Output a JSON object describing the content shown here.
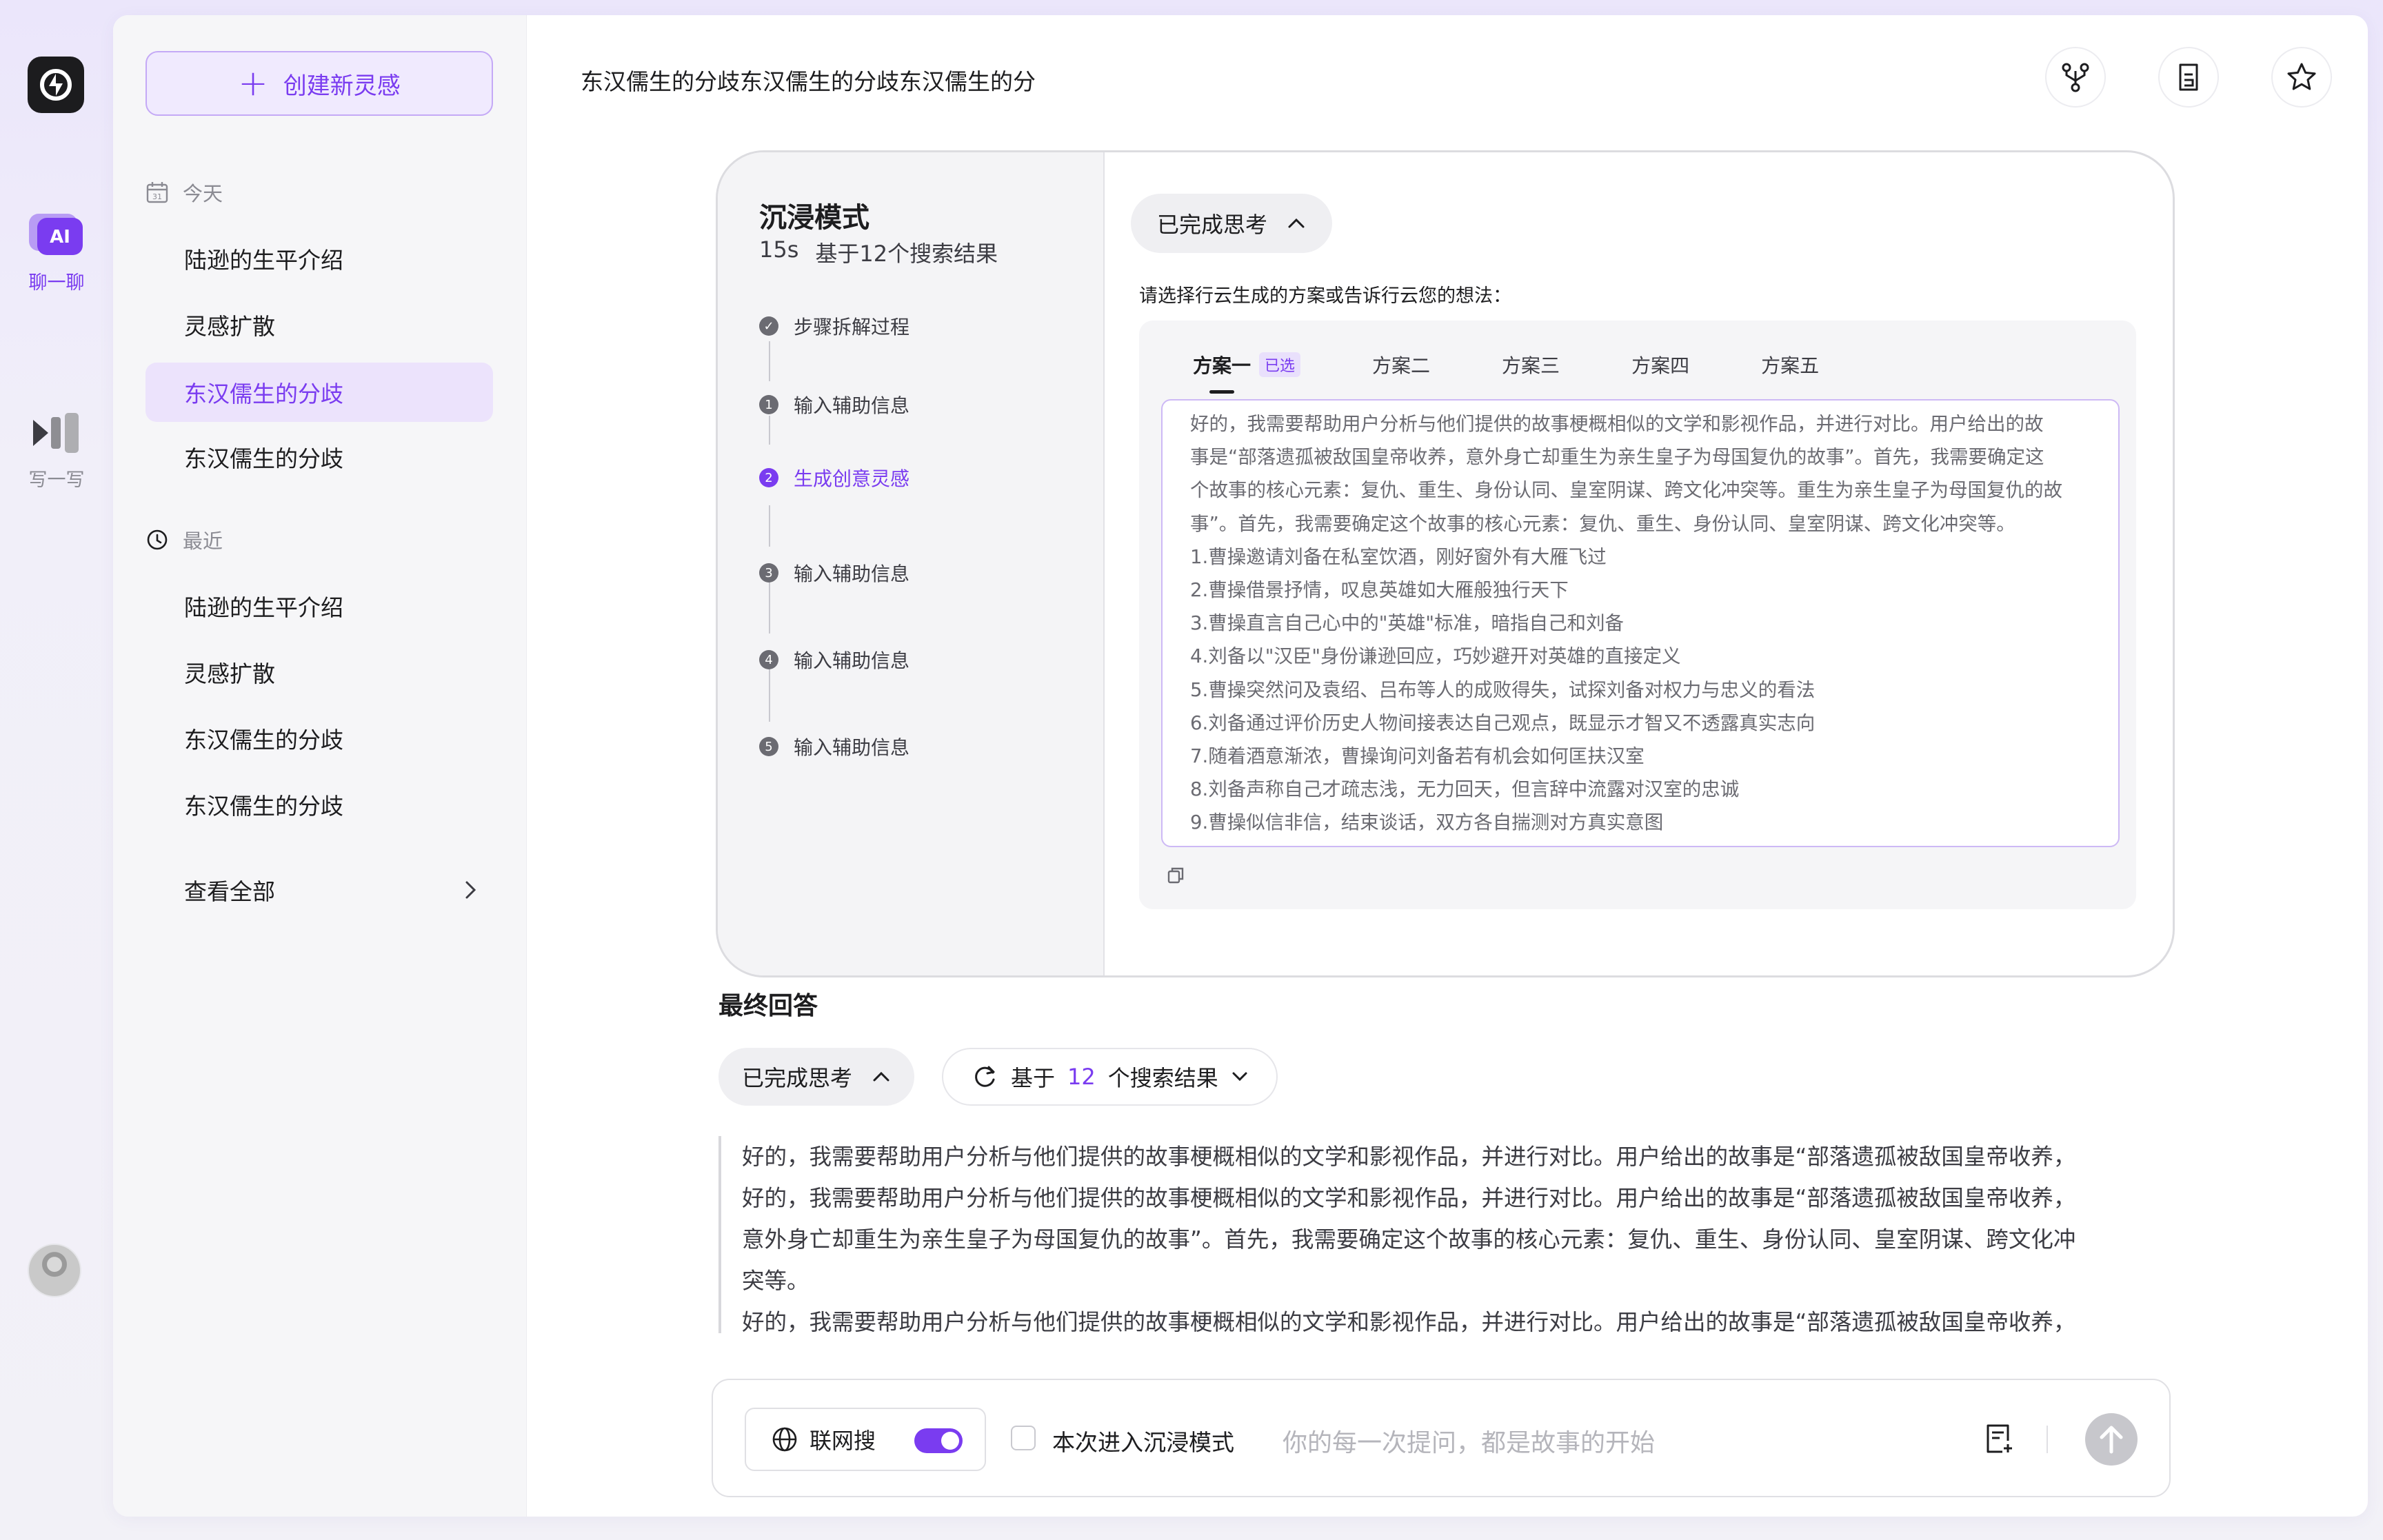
{
  "rail": {
    "chat_label": "聊一聊",
    "write_label": "写一写"
  },
  "sidebar": {
    "new_button": "创建新灵感",
    "today_title": "今天",
    "today_items": [
      "陆逊的生平介绍",
      "灵感扩散",
      "东汉儒生的分歧",
      "东汉儒生的分歧"
    ],
    "recent_title": "最近",
    "recent_items": [
      "陆逊的生平介绍",
      "灵感扩散",
      "东汉儒生的分歧",
      "东汉儒生的分歧"
    ],
    "see_all": "查看全部"
  },
  "header": {
    "title": "东汉儒生的分歧东汉儒生的分歧东汉儒生的分"
  },
  "immersive": {
    "title": "沉浸模式",
    "time": "15s",
    "search_info": "基于12个搜索结果",
    "steps": [
      "步骤拆解过程",
      "输入辅助信息",
      "生成创意灵感",
      "输入辅助信息",
      "输入辅助信息",
      "输入辅助信息"
    ],
    "step_numbers": [
      "✓",
      "1",
      "2",
      "3",
      "4",
      "5"
    ],
    "thinking_pill": "已完成思考",
    "hint": "请选择行云生成的方案或告诉行云您的想法：",
    "tabs": [
      "方案一",
      "方案二",
      "方案三",
      "方案四",
      "方案五"
    ],
    "selected_badge": "已选",
    "plan_lines": [
      "好的，我需要帮助用户分析与他们提供的故事梗概相似的文学和影视作品，并进行对比。用户给出的故",
      "事是“部落遗孤被敌国皇帝收养，意外身亡却重生为亲生皇子为母国复仇的故事”。首先，我需要确定这",
      "个故事的核心元素：复仇、重生、身份认同、皇室阴谋、跨文化冲突等。重生为亲生皇子为母国复仇的故",
      "事”。首先，我需要确定这个故事的核心元素：复仇、重生、身份认同、皇室阴谋、跨文化冲突等。",
      "1.曹操邀请刘备在私室饮酒，刚好窗外有大雁飞过",
      "2.曹操借景抒情，叹息英雄如大雁般独行天下",
      "3.曹操直言自己心中的\"英雄\"标准，暗指自己和刘备",
      "4.刘备以\"汉臣\"身份谦逊回应，巧妙避开对英雄的直接定义",
      "5.曹操突然问及袁绍、吕布等人的成败得失，试探刘备对权力与忠义的看法",
      "6.刘备通过评价历史人物间接表达自己观点，既显示才智又不透露真实志向",
      "7.随着酒意渐浓，曹操询问刘备若有机会如何匡扶汉室",
      "8.刘备声称自己才疏志浅，无力回天，但言辞中流露对汉室的忠诚",
      "9.曹操似信非信，结束谈话，双方各自揣测对方真实意图"
    ]
  },
  "final": {
    "title": "最终回答",
    "thinking_pill": "已完成思考",
    "search_prefix": "基于",
    "search_count": "12",
    "search_suffix": "个搜索结果",
    "answer_lines": [
      "好的，我需要帮助用户分析与他们提供的故事梗概相似的文学和影视作品，并进行对比。用户给出的故事是“部落遗孤被敌国皇帝收养，",
      "好的，我需要帮助用户分析与他们提供的故事梗概相似的文学和影视作品，并进行对比。用户给出的故事是“部落遗孤被敌国皇帝收养，",
      "意外身亡却重生为亲生皇子为母国复仇的故事”。首先，我需要确定这个故事的核心元素：复仇、重生、身份认同、皇室阴谋、跨文化冲",
      "突等。",
      "好的，我需要帮助用户分析与他们提供的故事梗概相似的文学和影视作品，并进行对比。用户给出的故事是“部落遗孤被敌国皇帝收养，"
    ]
  },
  "input": {
    "web_search_label": "联网搜",
    "web_search_on": true,
    "immersive_checkbox_label": "本次进入沉浸模式",
    "placeholder": "你的每一次提问，都是故事的开始"
  },
  "colors": {
    "accent": "#7a3cf0",
    "accent_light": "#ece3fc"
  }
}
